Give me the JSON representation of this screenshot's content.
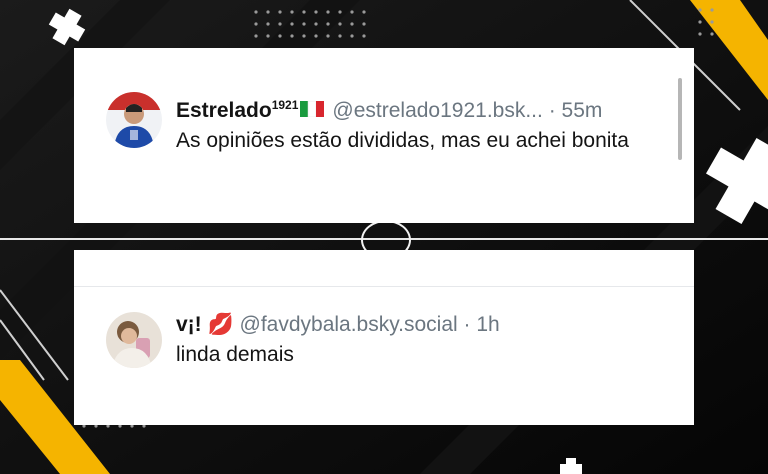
{
  "posts": [
    {
      "name": "Estrelado",
      "name_sup": "1921",
      "handle": "@estrelado1921.bsk...",
      "time": "· 55m",
      "text": "As opiniões estão divididas, mas eu achei bonita",
      "avatar": "avatar-person-blue-jersey",
      "flag": "italy-flag-icon"
    },
    {
      "name": "v¡! 💋",
      "handle": "@favdybala.bsky.social",
      "time": "· 1h",
      "text": "linda demais",
      "avatar": "avatar-person-photo"
    }
  ],
  "colors": {
    "accent_yellow": "#f5b400",
    "bg_dark": "#0b0b0b",
    "muted_text": "#6b7680"
  }
}
